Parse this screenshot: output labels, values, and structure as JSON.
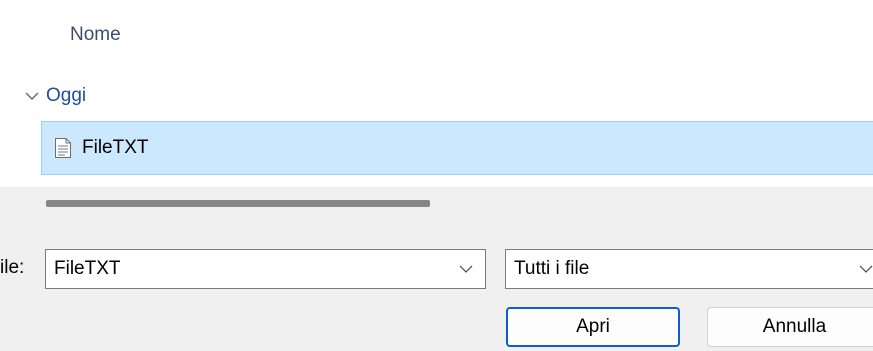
{
  "file_list": {
    "column_header": "Nome",
    "group": {
      "label": "Oggi",
      "icon": "chevron-down-icon"
    },
    "files": [
      {
        "name": "FileTXT",
        "icon": "text-file-icon",
        "selected": true
      }
    ]
  },
  "scrollbar": {
    "orientation": "horizontal"
  },
  "filename": {
    "label": "ile:",
    "value": "FileTXT"
  },
  "file_type": {
    "value": "Tutti i file"
  },
  "buttons": {
    "open_label": "Apri",
    "cancel_label": "Annulla"
  },
  "colors": {
    "selection_bg": "#cce8ff",
    "selection_border": "#99d1ff",
    "group_text": "#1f4e9c",
    "header_text": "#3c4d6b",
    "accent_border": "#0b5cd5",
    "panel_bg": "#f0f0f0"
  }
}
